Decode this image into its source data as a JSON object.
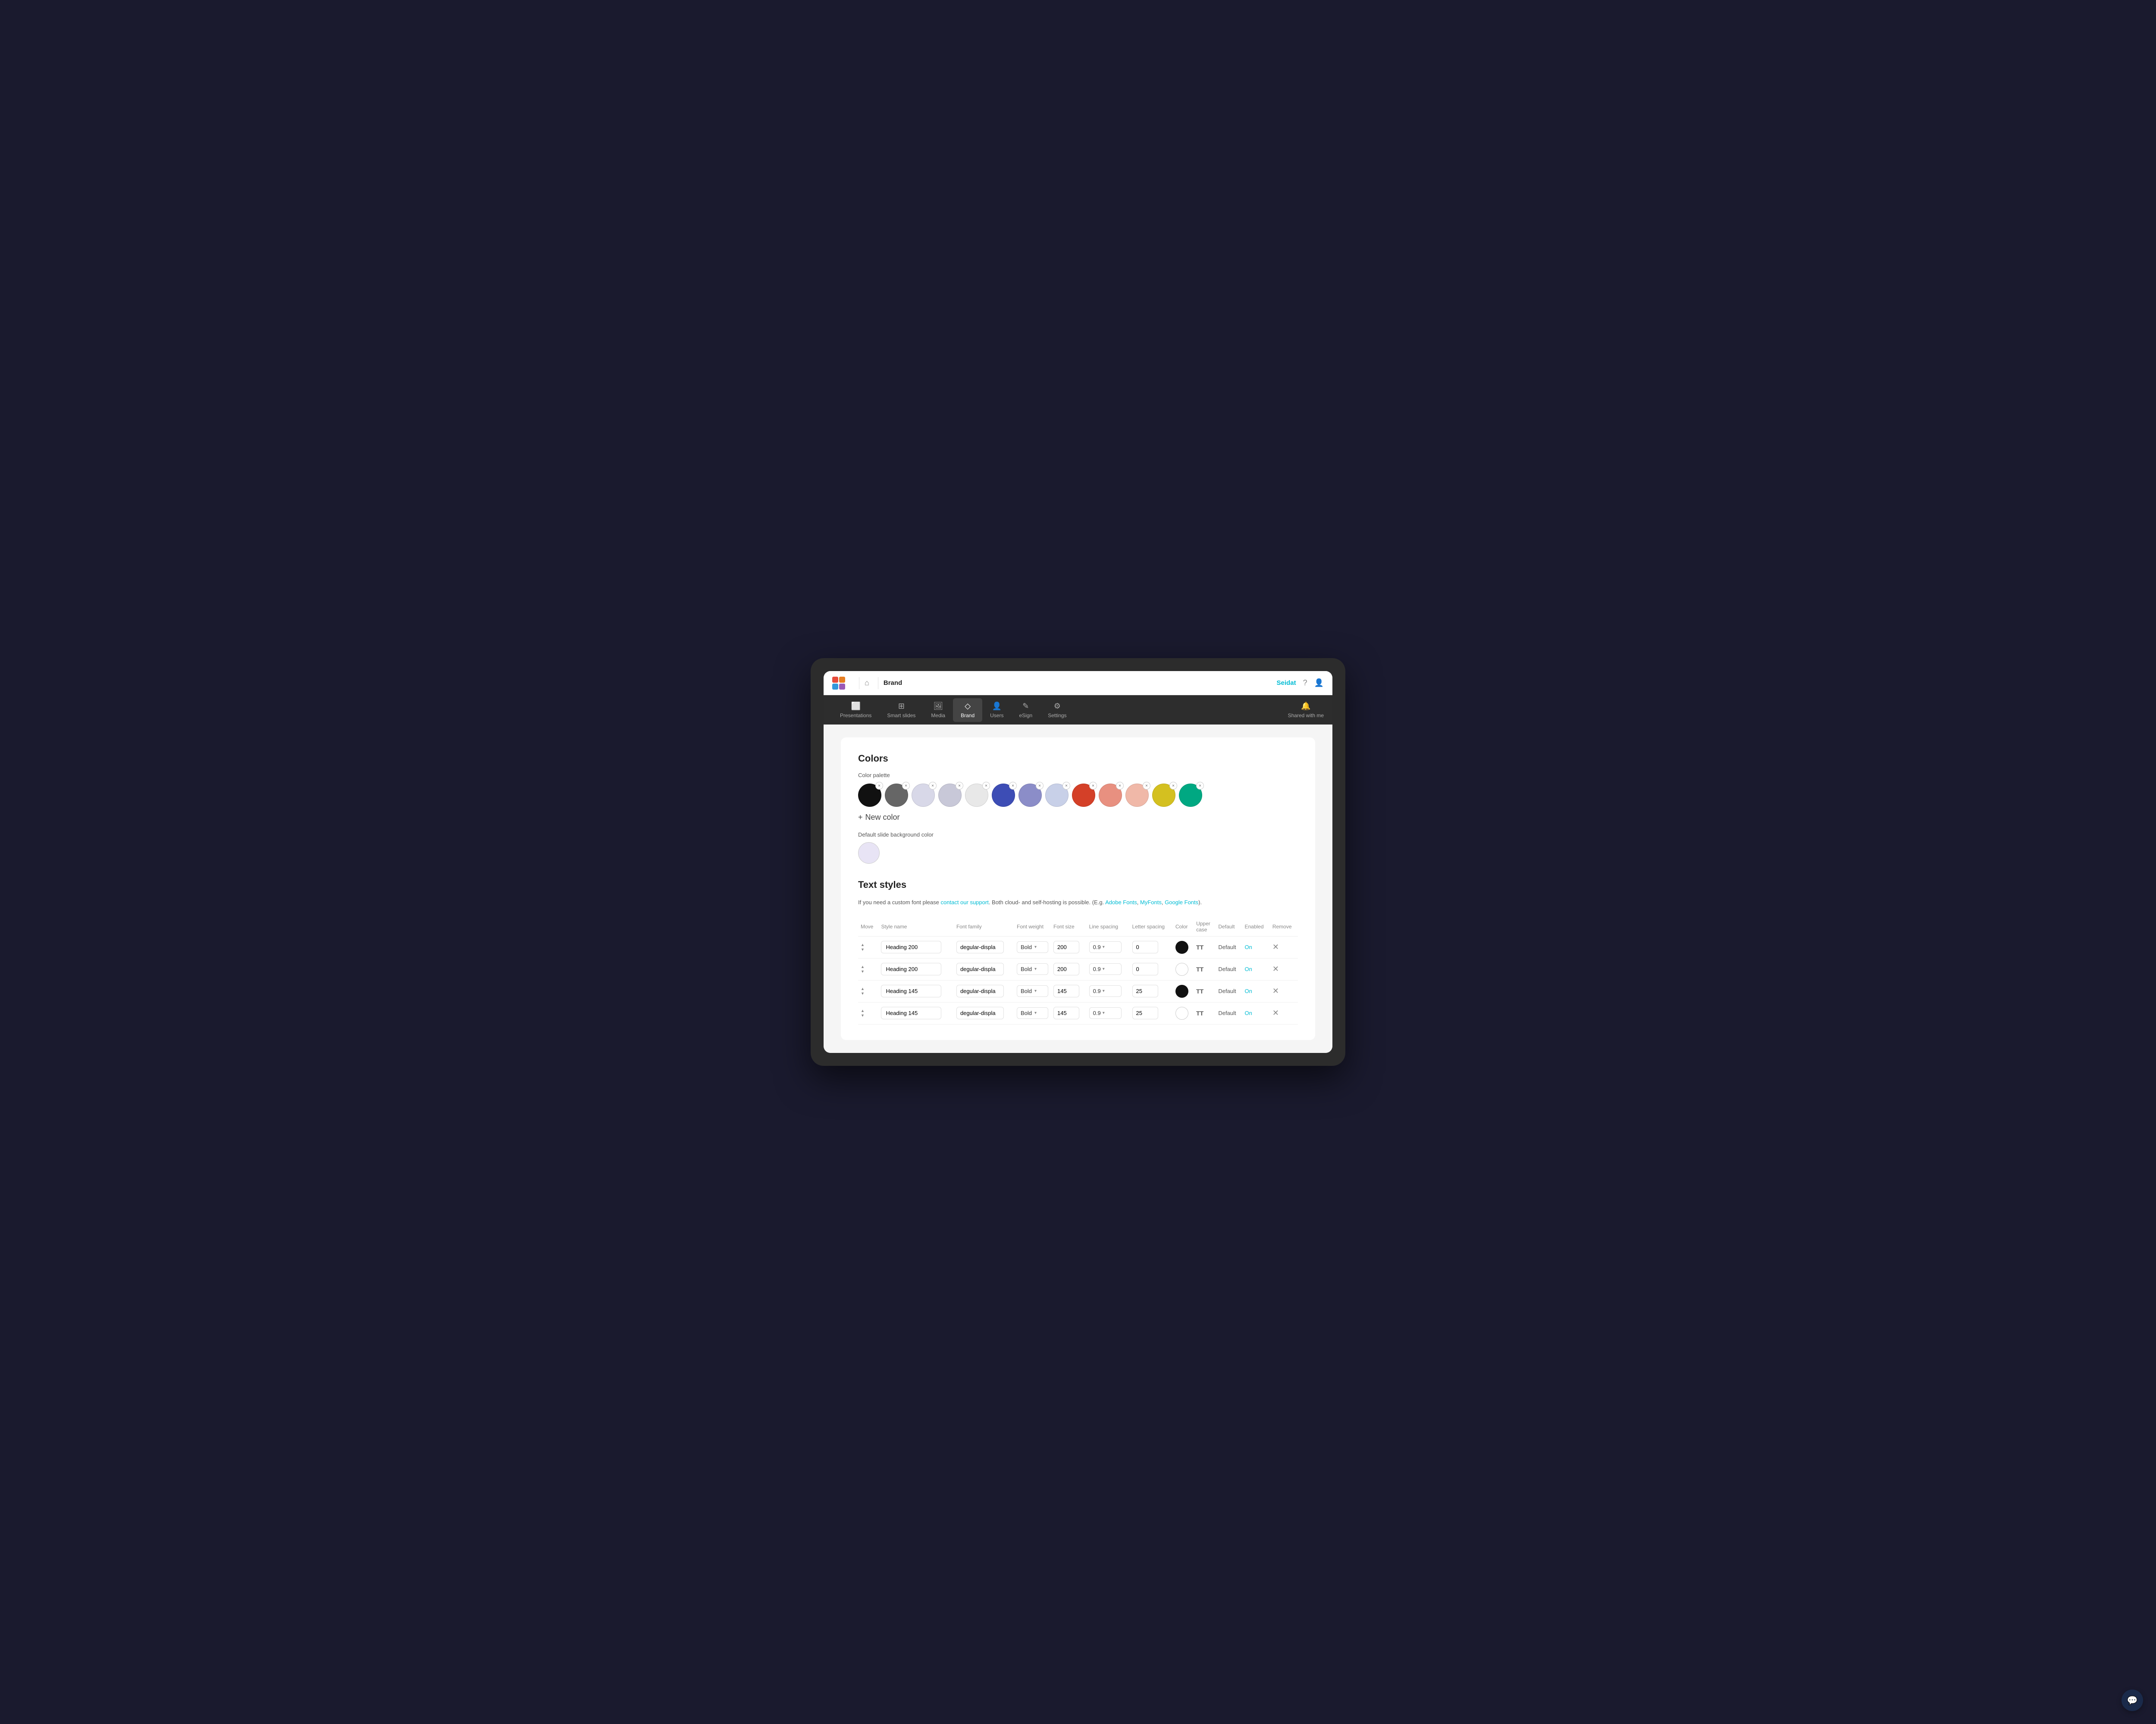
{
  "topbar": {
    "brand_label": "Brand",
    "seidat_label": "Seidat",
    "home_icon": "🏠",
    "help_icon": "?",
    "user_icon": "👤"
  },
  "navbar": {
    "items": [
      {
        "id": "presentations",
        "label": "Presentations",
        "icon": "▣",
        "active": false
      },
      {
        "id": "smart-slides",
        "label": "Smart slides",
        "icon": "⊞",
        "active": false
      },
      {
        "id": "media",
        "label": "Media",
        "icon": "🖼",
        "active": false
      },
      {
        "id": "brand",
        "label": "Brand",
        "icon": "◇",
        "active": true
      },
      {
        "id": "users",
        "label": "Users",
        "icon": "👤",
        "active": false
      },
      {
        "id": "esign",
        "label": "eSign",
        "icon": "✎",
        "active": false
      },
      {
        "id": "settings",
        "label": "Settings",
        "icon": "⚙",
        "active": false
      }
    ],
    "shared_label": "Shared with me",
    "shared_icon": "🔔"
  },
  "colors_section": {
    "title": "Colors",
    "palette_label": "Color palette",
    "swatches": [
      {
        "color": "#111111"
      },
      {
        "color": "#666666"
      },
      {
        "color": "#d8d8e8"
      },
      {
        "color": "#c8c8d8"
      },
      {
        "color": "#e8e8e8"
      },
      {
        "color": "#3d4db5"
      },
      {
        "color": "#8b8dc8"
      },
      {
        "color": "#c8d0e8"
      },
      {
        "color": "#d44028"
      },
      {
        "color": "#e89080"
      },
      {
        "color": "#f0b8a8"
      },
      {
        "color": "#d4c020"
      },
      {
        "color": "#00a882"
      }
    ],
    "add_color_label": "New color",
    "default_bg_label": "Default slide background color",
    "default_bg_color": "#e8e4f5"
  },
  "text_styles_section": {
    "title": "Text styles",
    "note_prefix": "If you need a custom font please ",
    "note_link1": "contact our support",
    "note_mid": ". Both cloud- and self-hosting is possible. (E.g. ",
    "note_link2": "Adobe Fonts",
    "note_comma1": ", ",
    "note_link3": "MyFonts",
    "note_comma2": ", ",
    "note_link4": "Google Fonts",
    "note_suffix": ").",
    "table_headers": {
      "move": "Move",
      "style_name": "Style name",
      "font_family": "Font family",
      "font_weight": "Font weight",
      "font_size": "Font size",
      "line_spacing": "Line spacing",
      "letter_spacing": "Letter spacing",
      "color": "Color",
      "upper_case": "Upper case",
      "default": "Default",
      "enabled": "Enabled",
      "remove": "Remove"
    },
    "rows": [
      {
        "style_name": "Heading 200",
        "font_family": "degular-displa",
        "font_weight": "Bold",
        "font_size": "200",
        "line_spacing": "0.9",
        "letter_spacing": "0",
        "color": "#111111",
        "upper_case": "TT",
        "default_val": "Default",
        "enabled": "On",
        "has_color": true
      },
      {
        "style_name": "Heading 200",
        "font_family": "degular-displa",
        "font_weight": "Bold",
        "font_size": "200",
        "line_spacing": "0.9",
        "letter_spacing": "0",
        "color": "#ffffff",
        "upper_case": "TT",
        "default_val": "Default",
        "enabled": "On",
        "has_color": true,
        "color_border": true
      },
      {
        "style_name": "Heading 145",
        "font_family": "degular-displa",
        "font_weight": "Bold",
        "font_size": "145",
        "line_spacing": "0.9",
        "letter_spacing": "25",
        "color": "#111111",
        "upper_case": "TT",
        "default_val": "Default",
        "enabled": "On",
        "has_color": true
      },
      {
        "style_name": "Heading 145",
        "font_family": "degular-displa",
        "font_weight": "Bold",
        "font_size": "145",
        "line_spacing": "0.9",
        "letter_spacing": "25",
        "color": "#ffffff",
        "upper_case": "TT",
        "default_val": "Default",
        "enabled": "On",
        "has_color": true,
        "color_border": true
      }
    ]
  }
}
